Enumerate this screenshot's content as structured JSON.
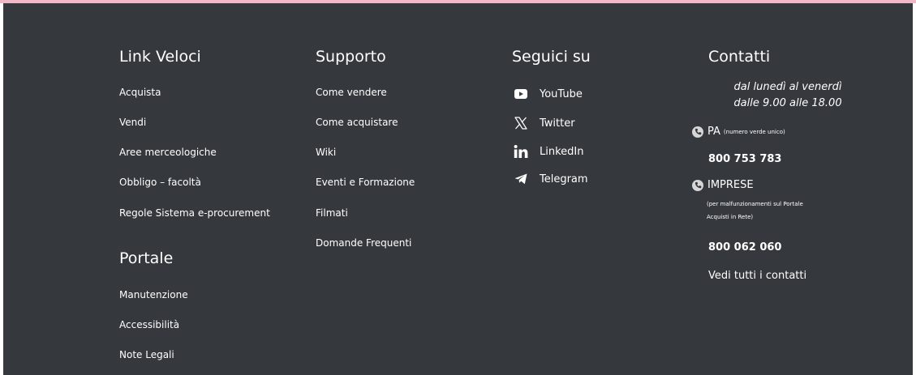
{
  "link_veloci": {
    "title": "Link Veloci",
    "items": [
      "Acquista",
      "Vendi",
      "Aree merceologiche",
      "Obbligo – facoltà",
      "Regole Sistema e-procurement"
    ]
  },
  "portale": {
    "title": "Portale",
    "items": [
      "Manutenzione",
      "Accessibilità",
      "Note Legali"
    ]
  },
  "supporto": {
    "title": "Supporto",
    "items": [
      "Come vendere",
      "Come acquistare",
      "Wiki",
      "Eventi e Formazione",
      "Filmati",
      "Domande Frequenti"
    ]
  },
  "social": {
    "title": "Seguici su",
    "items": [
      {
        "label": "YouTube",
        "icon": "youtube-icon"
      },
      {
        "label": "Twitter",
        "icon": "x-twitter-icon"
      },
      {
        "label": "LinkedIn",
        "icon": "linkedin-icon"
      },
      {
        "label": "Telegram",
        "icon": "telegram-icon"
      }
    ]
  },
  "contatti": {
    "title": "Contatti",
    "hours_line1": "dal lunedì al venerdì",
    "hours_line2": "dalle 9.00 alle 18.00",
    "pa_label": "PA",
    "pa_note": "(numero verde unico)",
    "pa_number": "800 753 783",
    "imprese_label": "IMPRESE",
    "imprese_note_line1": "(per malfunzionamenti sul Portale",
    "imprese_note_line2": "Acquisti in Rete)",
    "imprese_number": "800 062 060",
    "all_contacts": "Vedi tutti i contatti"
  },
  "colors": {
    "footer_bg": "#35383d",
    "top_accent": "#f1b8c8",
    "text": "#ffffff",
    "phone_icon": "#d6d6d6"
  }
}
